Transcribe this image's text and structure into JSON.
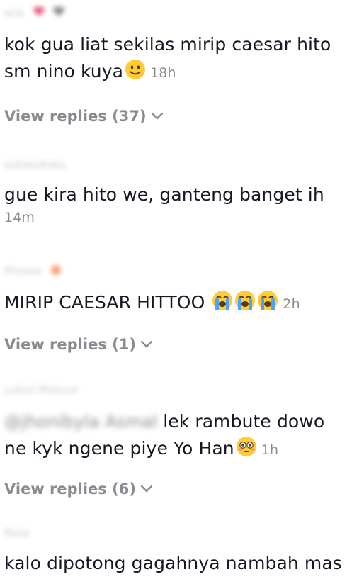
{
  "comments": [
    {
      "username": "arie",
      "text_line1": "kok gua liat sekilas mirip caesar hito",
      "text_line2": "sm nino kuya",
      "emoji": "slightly-smiling-face",
      "time": "18h",
      "replies_label": "View replies (37)"
    },
    {
      "username": "sukasukaku",
      "text": "gue kira hito we, ganteng banget ih",
      "time": "14m"
    },
    {
      "username": "Miyooo",
      "text": "MIRIP CAESAR HITTOO",
      "emoji": "loudly-crying-face",
      "time": "2h",
      "replies_label": "View replies (1)"
    },
    {
      "username": "Lukiul Mekrun",
      "mention": "@jhonibyla Asmal",
      "text_line1": " lek rambute dowo",
      "text_line2": "ne kyk ngene piye Yo Han",
      "emoji": "flushed-face",
      "time": "1h",
      "replies_label": "View replies (6)"
    },
    {
      "username": "Rose",
      "text": "kalo dipotong gagahnya nambah mas"
    }
  ]
}
